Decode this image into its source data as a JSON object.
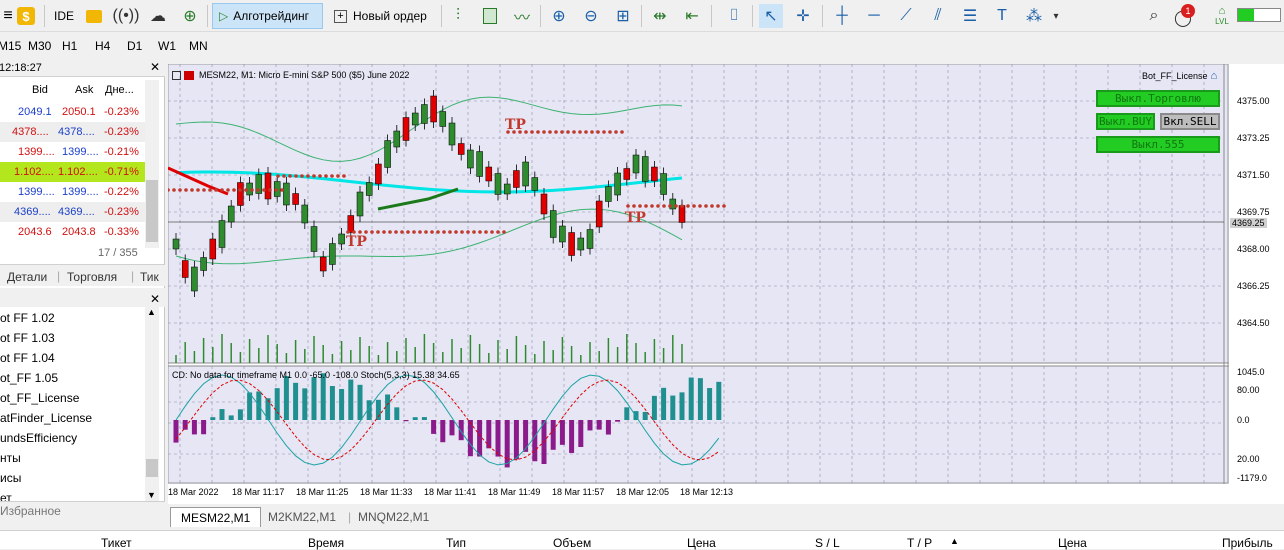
{
  "toolbar": {
    "ide_label": "IDE",
    "algo_label": "Алготрейдинг",
    "new_order_label": "Новый ордер",
    "notification_count": "1",
    "lvl_label": "LVL"
  },
  "timeframes": [
    "M15",
    "M30",
    "H1",
    "H4",
    "D1",
    "W1",
    "MN"
  ],
  "market_watch": {
    "time": "12:18:27",
    "headers": {
      "bid": "Bid",
      "ask": "Ask",
      "change": "Дне..."
    },
    "rows": [
      {
        "bid": "2049.1",
        "ask": "2050.1",
        "change": "-0.23%"
      },
      {
        "bid": "4378....",
        "ask": "4378....",
        "change": "-0.23%"
      },
      {
        "bid": "1399....",
        "ask": "1399....",
        "change": "-0.21%"
      },
      {
        "bid": "1.102....",
        "ask": "1.102....",
        "change": "-0.71%"
      },
      {
        "bid": "1399....",
        "ask": "1399....",
        "change": "-0.22%"
      },
      {
        "bid": "4369....",
        "ask": "4369....",
        "change": "-0.23%"
      },
      {
        "bid": "2043.6",
        "ask": "2043.8",
        "change": "-0.33%"
      }
    ],
    "count": "17 / 355",
    "tabs": [
      "Детали",
      "Торговля",
      "Тик"
    ]
  },
  "navigator": {
    "items": [
      "ot FF 1.02",
      "ot FF 1.03",
      "ot FF 1.04",
      "ot_FF 1.05",
      "ot_FF_License",
      "atFinder_License",
      "undsEfficiency",
      "нты",
      "исы",
      "ет"
    ],
    "favorites": "Избранное"
  },
  "chart": {
    "title": "MESM22, M1:  Micro E-mini S&P 500 ($5) June 2022",
    "expert": "Bot_FF_License",
    "indicator_label": "CD: No data for timeframe M1 0.0 -65.0 -108.0 Stoch(5,3,3) 15.38 34.65",
    "price_ticks": [
      "4375.00",
      "4373.25",
      "4371.50",
      "4369.75",
      "4368.00",
      "4366.25",
      "4364.50"
    ],
    "current_price": "4369.25",
    "osc_ticks": [
      "1045.0",
      "80.00",
      "0.0",
      "20.00",
      "-1179.0"
    ],
    "time_labels": [
      "18 Mar 2022",
      "18 Mar 11:17",
      "18 Mar 11:25",
      "18 Mar 11:33",
      "18 Mar 11:41",
      "18 Mar 11:49",
      "18 Mar 11:57",
      "18 Mar 12:05",
      "18 Mar 12:13"
    ],
    "tp_label": "TP",
    "buttons": {
      "trading_off": "Выкл.Торговлю",
      "buy_off": "Выкл.BUY",
      "sell_on": "Вкл.SELL",
      "s555_off": "Выкл.555"
    },
    "colors": {
      "background": "#e6e6f5",
      "up": "#2e8b2e",
      "down": "#e00000",
      "mid_line": "#00e5e5",
      "bands": "#3cb371",
      "tp_dots": "#c0392b",
      "hist_pos": "#1f8f8f",
      "hist_neg": "#8b1a8b"
    }
  },
  "chart_tabs": [
    "MESM22,M1",
    "M2KM22,M1",
    "MNQM22,M1"
  ],
  "terminal_headers": [
    "Тикет",
    "Время",
    "Тип",
    "Объем",
    "Цена",
    "S / L",
    "T / P",
    "Цена",
    "Прибыль"
  ]
}
